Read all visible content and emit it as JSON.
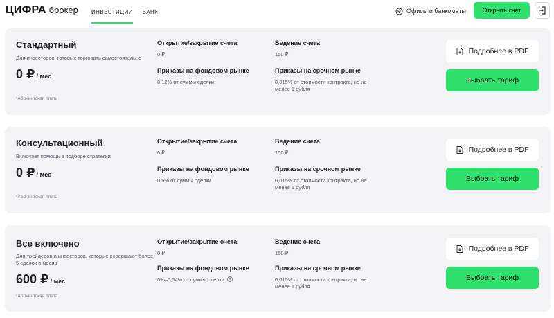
{
  "header": {
    "logo_main": "ЦИФРА",
    "logo_sub": "брокер",
    "nav": [
      {
        "label": "ИНВЕСТИЦИИ",
        "active": true
      },
      {
        "label": "БАНК",
        "active": false
      }
    ],
    "offices_label": "Офисы и банкоматы",
    "open_account_label": "Открыть счет",
    "icons": {
      "pin": "map-pin-icon",
      "login": "login-icon"
    },
    "accent_color": "#2ee06c"
  },
  "tariffs": [
    {
      "title": "Стандартный",
      "description": "Для инвесторов, готовых торговать самостоятельно",
      "price": "0 ₽",
      "price_unit": "/ мес",
      "fee_note": "*Абонентская плата",
      "open_close_label": "Открытие/закрытие счета",
      "open_close_value": "0 ₽",
      "maintenance_label": "Ведение счета",
      "maintenance_value": "150 ₽",
      "stock_label": "Приказы на фондовом рынке",
      "stock_value": "0,12% от суммы сделки",
      "futures_label": "Приказы на срочном рынке",
      "futures_value": "0,015% от стоимости контракта, но не менее 1 рубля",
      "pdf_label": "Подробнее в PDF",
      "choose_label": "Выбрать тариф"
    },
    {
      "title": "Консультационный",
      "description": "Включает помощь в подборе стратегии",
      "price": "0 ₽",
      "price_unit": "/ мес",
      "fee_note": "*Абонентская плата",
      "open_close_label": "Открытие/закрытие счета",
      "open_close_value": "0 ₽",
      "maintenance_label": "Ведение счета",
      "maintenance_value": "150 ₽",
      "stock_label": "Приказы на фондовом рынке",
      "stock_value": "0,5% от суммы сделки",
      "futures_label": "Приказы на срочном рынке",
      "futures_value": "0,015% от стоимости контракта, но не менее 1 рубля",
      "pdf_label": "Подробнее в PDF",
      "choose_label": "Выбрать тариф"
    },
    {
      "title": "Все включено",
      "description": "Для трейдеров и инвесторов, которые совершают более 5 сделок в месяц",
      "price": "600 ₽",
      "price_unit": "/ мес",
      "fee_note": "*Абонентская плата",
      "open_close_label": "Открытие/закрытие счета",
      "open_close_value": "0 ₽",
      "maintenance_label": "Ведение счета",
      "maintenance_value": "150 ₽",
      "stock_label": "Приказы на фондовом рынке",
      "stock_value": "0%–0,04% от суммы сделки",
      "futures_label": "Приказы на срочном рынке",
      "futures_value": "0,015% от стоимости контракта, но не менее 1 рубля",
      "pdf_label": "Подробнее в PDF",
      "choose_label": "Выбрать тариф"
    }
  ]
}
